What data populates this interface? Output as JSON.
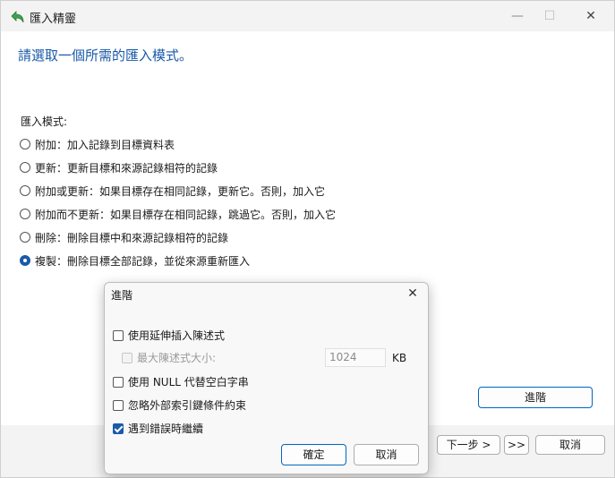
{
  "window": {
    "title": "匯入精靈",
    "minimize_glyph": "—",
    "maximize_glyph": "☐",
    "close_glyph": "✕"
  },
  "heading": "請選取一個所需的匯入模式。",
  "import_mode_label": "匯入模式:",
  "modes": [
    {
      "label": "附加：加入記錄到目標資料表",
      "selected": false
    },
    {
      "label": "更新：更新目標和來源記錄相符的記錄",
      "selected": false
    },
    {
      "label": "附加或更新：如果目標存在相同記錄，更新它。否則，加入它",
      "selected": false
    },
    {
      "label": "附加而不更新：如果目標存在相同記錄，跳過它。否則，加入它",
      "selected": false
    },
    {
      "label": "刪除：刪除目標中和來源記錄相符的記錄",
      "selected": false
    },
    {
      "label": "複製：刪除目標全部記錄，並從來源重新匯入",
      "selected": true
    }
  ],
  "advanced_button": "進階",
  "footer": {
    "next_button": "下一步 >",
    "skip_button": ">>",
    "cancel_button": "取消"
  },
  "dialog": {
    "title": "進階",
    "close_glyph": "✕",
    "options": {
      "extended_insert": {
        "label": "使用延伸插入陳述式",
        "checked": false
      },
      "max_statement_size": {
        "label": "最大陳述式大小:",
        "checked": false,
        "disabled": true,
        "value": "1024",
        "unit": "KB"
      },
      "null_empty": {
        "label": "使用 NULL 代替空白字串",
        "checked": false
      },
      "ignore_fk": {
        "label": "忽略外部索引鍵條件約束",
        "checked": false
      },
      "continue_on_error": {
        "label": "遇到錯誤時繼續",
        "checked": true
      }
    },
    "ok_button": "確定",
    "cancel_button": "取消"
  },
  "colors": {
    "accent": "#1a5aa8",
    "button_border_primary": "#0067c0",
    "titlebar": "#f3f3f3"
  },
  "icons": {
    "app": "green-back-arrow-icon",
    "minimize": "minimize-icon",
    "maximize": "maximize-icon",
    "close": "close-icon"
  }
}
